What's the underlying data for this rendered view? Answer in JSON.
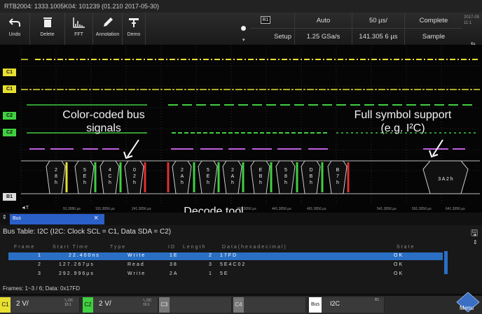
{
  "title_bar": "RTB2004: 1333.1005K04: 101239 (01.210 2017-05-30)",
  "toolbar": {
    "tools": [
      {
        "label": "Undo",
        "icon": "undo-icon"
      },
      {
        "label": "Delete",
        "icon": "trash-icon"
      },
      {
        "label": "FFT",
        "icon": "fft-icon"
      },
      {
        "label": "Annotation",
        "icon": "pen-icon"
      },
      {
        "label": "Demo",
        "icon": "demo-icon"
      }
    ],
    "bus_tag": "B1",
    "setup_label": "Setup",
    "trigger_mode": "Auto",
    "sample_rate": "1.25 GSa/s",
    "timebase": "50 µs/",
    "trigger_position": "141.305 6 µs",
    "acquisition": "Complete",
    "acq_mode": "Sample",
    "datetime_line1": "2017-05",
    "datetime_line2": "11:1",
    "usb_icon": "usb-icon"
  },
  "channels": {
    "c1_label": "C1",
    "c2_label": "C2",
    "b1_label": "B1",
    "c1_color": "#e8e030",
    "c2_color": "#40d040",
    "bus_color": "#c060e0"
  },
  "annotations": {
    "bus_signals_line1": "Color-coded bus",
    "bus_signals_line2": "signals",
    "symbol_support_line1": "Full symbol support",
    "symbol_support_line2": "(e.g. I²C)",
    "decode_tool": "Decode tool"
  },
  "decode_symbols": [
    "2 8 h",
    "5 E h",
    "4 C h",
    "0 2 h",
    "2 A h",
    "5 E h",
    "2 A h",
    "E B h",
    "5 8 h",
    "D B h",
    "B 7 h",
    "3 A 2 h"
  ],
  "time_axis": {
    "t_marker": "◄T",
    "labels": [
      "91.3056 µs",
      "191.3056 µs",
      "241.3056 µs",
      "341.3056 µs",
      "391.3056 µs",
      "441.3056 µs",
      "491.3056 µs",
      "541.3056 µs",
      "591.3056 µs",
      "641.3056 µs"
    ]
  },
  "bus_tab": {
    "label": "Bus",
    "close": "×",
    "arrows": "⇕"
  },
  "bus_table": {
    "title": "Bus Table: I2C (I2C: Clock SCL = C1, Data SDA = C2)",
    "columns": [
      "Frame",
      "Start Time",
      "Type",
      "ID",
      "Length",
      "Data(hexadecimal)",
      "State"
    ],
    "rows": [
      {
        "frame": "1",
        "start": "22.400ns",
        "type": "Write",
        "id": "1E",
        "length": "2",
        "data": "17FD",
        "state": "OK"
      },
      {
        "frame": "2",
        "start": "127.267µs",
        "type": "Read",
        "id": "38",
        "length": "3",
        "data": "5E4C02",
        "state": "OK"
      },
      {
        "frame": "3",
        "start": "292.996µs",
        "type": "Write",
        "id": "2A",
        "length": "1",
        "data": "5E",
        "state": "OK"
      }
    ],
    "footer": "Frames: 1~3 / 6; Data: 0x17FD",
    "save_icon": "save-icon"
  },
  "channel_bar": {
    "c1": {
      "label": "C1",
      "value": "2 V/",
      "sub1": "⁰ᵤ DC",
      "sub2": "10:1"
    },
    "c2": {
      "label": "C2",
      "value": "2 V/",
      "sub1": "⁰ᵤ DC",
      "sub2": "10:1"
    },
    "c3": {
      "label": "C3"
    },
    "c4": {
      "label": "C4"
    },
    "bus": {
      "label": "Bus",
      "protocol": "I2C",
      "bus_id": "B1"
    },
    "menu_label": "Menu"
  }
}
